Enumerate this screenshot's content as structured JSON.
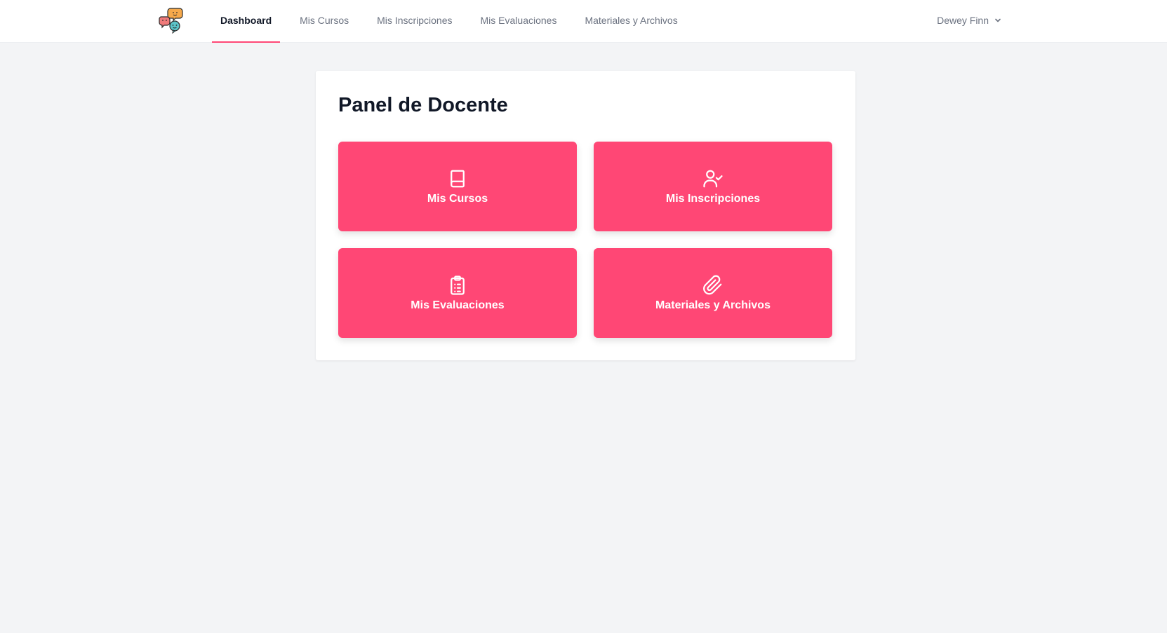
{
  "nav": {
    "items": [
      {
        "label": "Dashboard",
        "active": true
      },
      {
        "label": "Mis Cursos",
        "active": false
      },
      {
        "label": "Mis Inscripciones",
        "active": false
      },
      {
        "label": "Mis Evaluaciones",
        "active": false
      },
      {
        "label": "Materiales y Archivos",
        "active": false
      }
    ]
  },
  "user": {
    "name": "Dewey Finn",
    "menu_icon": "chevron-down-icon"
  },
  "main": {
    "title": "Panel de Docente",
    "tiles": [
      {
        "label": "Mis Cursos",
        "icon": "book-icon"
      },
      {
        "label": "Mis Inscripciones",
        "icon": "user-check-icon"
      },
      {
        "label": "Mis Evaluaciones",
        "icon": "clipboard-list-icon"
      },
      {
        "label": "Materiales y Archivos",
        "icon": "paperclip-icon"
      }
    ]
  },
  "colors": {
    "accent": "#ff4775",
    "background": "#f3f4f6",
    "nav_text": "#6b7280",
    "heading": "#111827"
  }
}
